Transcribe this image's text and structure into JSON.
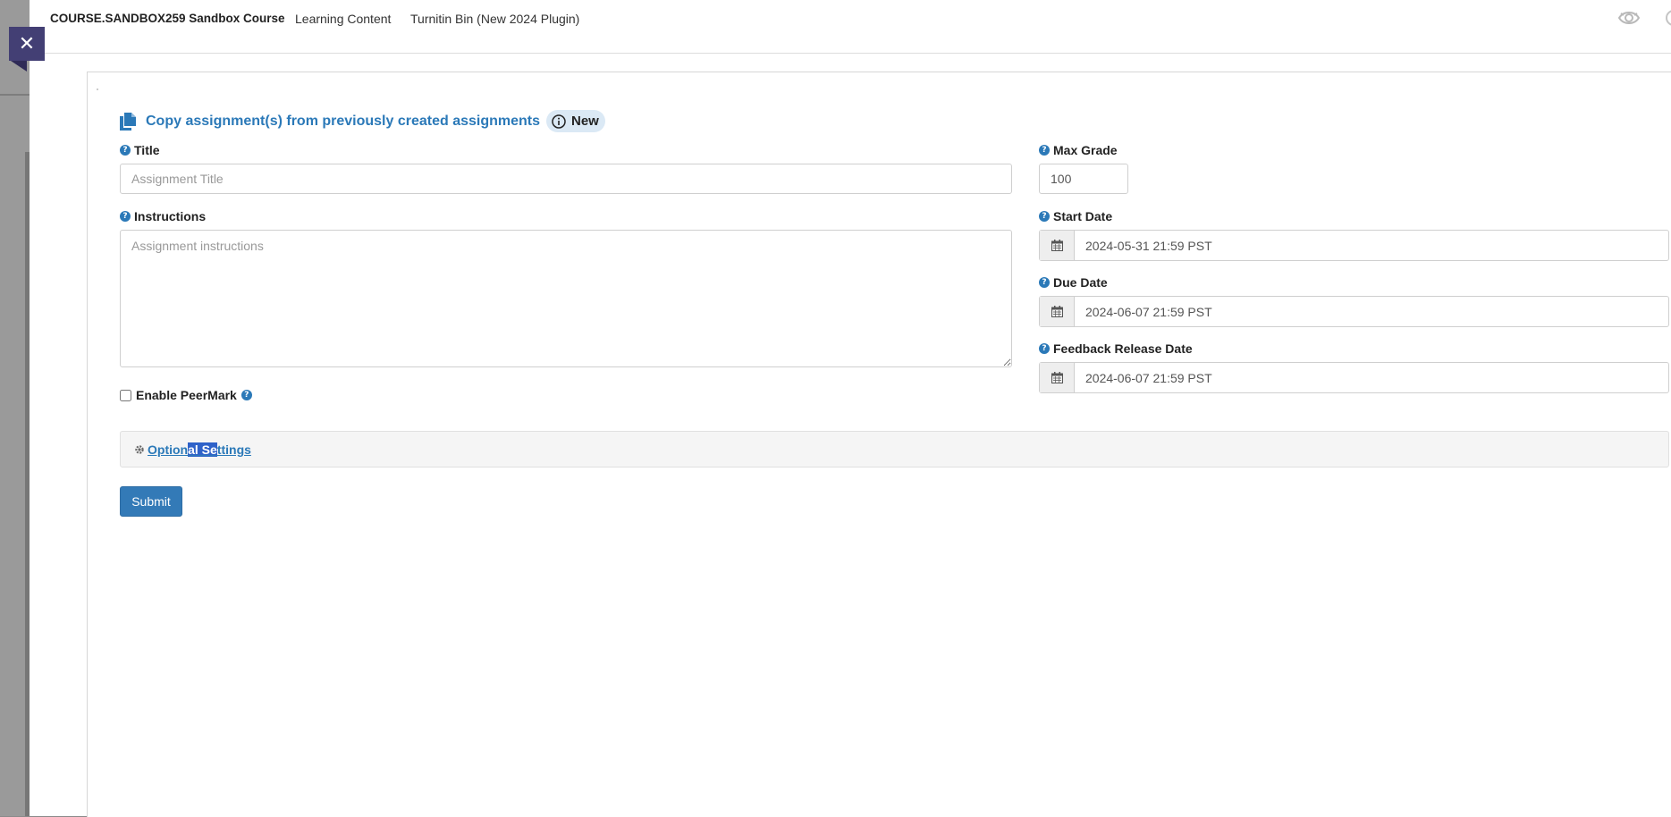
{
  "header": {
    "course_title": "COURSE.SANDBOX259 Sandbox Course",
    "nav": [
      "Learning Content",
      "Turnitin Bin (New 2024 Plugin)"
    ]
  },
  "close_button": {
    "icon": "close-icon",
    "glyph": "✕"
  },
  "copy_assignments": {
    "label": "Copy assignment(s) from previously created assignments",
    "badge": "New"
  },
  "form": {
    "title_label": "Title",
    "title_placeholder": "Assignment Title",
    "title_value": "",
    "instructions_label": "Instructions",
    "instructions_placeholder": "Assignment instructions",
    "instructions_value": "",
    "max_grade_label": "Max Grade",
    "max_grade_value": "100",
    "start_date_label": "Start Date",
    "start_date_value": "2024-05-31 21:59 PST",
    "due_date_label": "Due Date",
    "due_date_value": "2024-06-07 21:59 PST",
    "feedback_date_label": "Feedback Release Date",
    "feedback_date_value": "2024-06-07 21:59 PST",
    "peermark_label": "Enable PeerMark",
    "peermark_checked": false,
    "optional_settings_parts": [
      "Option",
      "al Se",
      "ttings"
    ],
    "submit_label": "Submit"
  },
  "colors": {
    "accent": "#2b79b8",
    "submit": "#337ab7",
    "close_bg": "#433f74",
    "badge_bg": "#dbe9f5",
    "selection": "#2f62c9"
  }
}
